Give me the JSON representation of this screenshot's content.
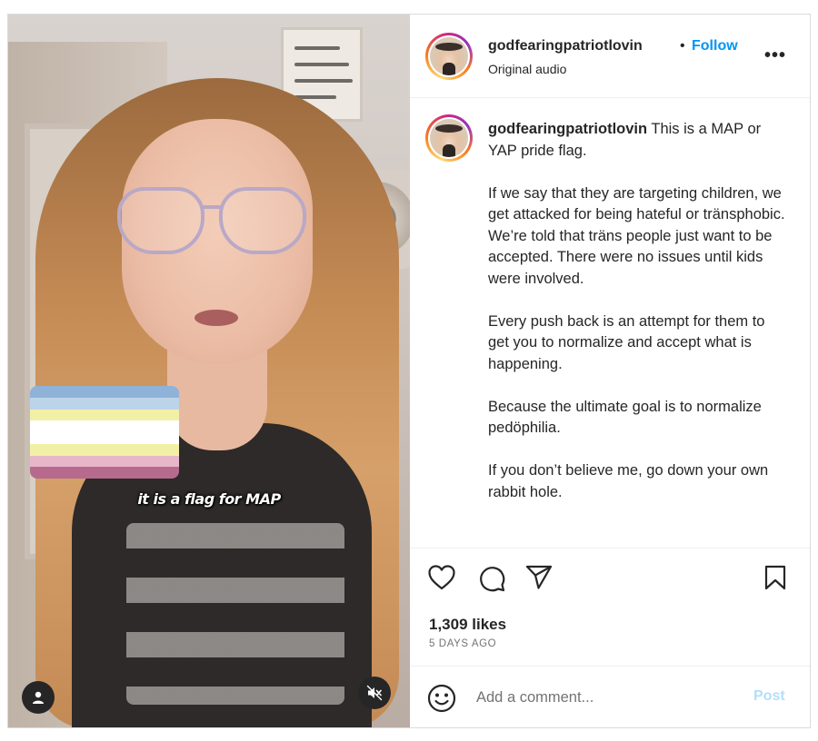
{
  "video": {
    "caption_overlay": "it is a flag for MAP",
    "flag_stripes": [
      "#8fb2d9",
      "#bcd4ea",
      "#f2f0a6",
      "#ffffff",
      "#ffffff",
      "#f2f0a6",
      "#e7b6c8",
      "#b56a8e"
    ],
    "user_icon": "person-icon",
    "mute_icon": "muted-speaker-icon"
  },
  "header": {
    "username": "godfearingpatriotlovin",
    "separator": "•",
    "follow_label": "Follow",
    "audio_label": "Original audio",
    "more_icon": "•••"
  },
  "caption": {
    "username": "godfearingpatriotlovin",
    "text": " This is a MAP or YAP pride flag.\n\nIf we say that they are targeting children, we get attacked for being hateful or tränsphobic. We’re told that träns people just want to be accepted. There were no issues until kids were involved.\n\nEvery push back is an attempt for them to get you to normalize and accept what is happening.\n\nBecause the ultimate goal is to normalize pedöphilia.\n\nIf you don’t believe me, go down your own rabbit hole."
  },
  "actions": {
    "icons": [
      "heart-icon",
      "comment-icon",
      "share-icon",
      "bookmark-icon"
    ],
    "likes": "1,309 likes",
    "date": "5 DAYS AGO"
  },
  "comment": {
    "placeholder": "Add a comment...",
    "post_label": "Post"
  },
  "colors": {
    "follow": "#0095f6",
    "post_disabled": "#b2dffc",
    "text": "#262626",
    "muted": "#737373"
  }
}
